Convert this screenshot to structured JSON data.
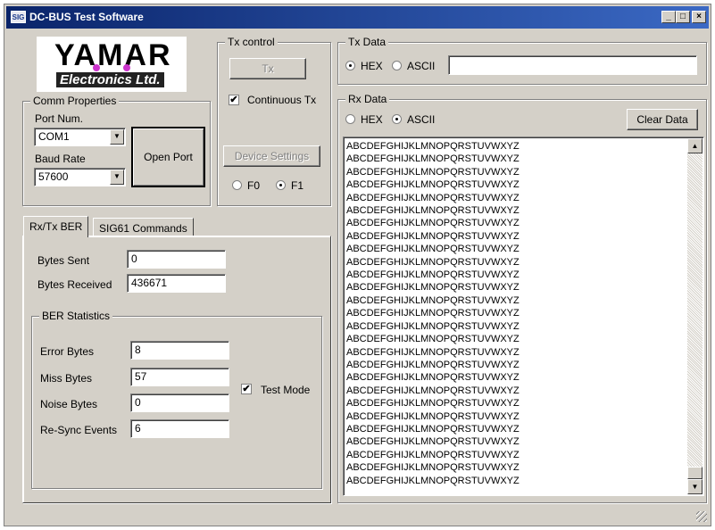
{
  "window": {
    "title": "DC-BUS Test Software",
    "icon_text": "SIG",
    "controls": {
      "minimize": "_",
      "maximize": "□",
      "close": "×"
    }
  },
  "logo": {
    "word1": "YAMAR",
    "word2": "Electronics Ltd."
  },
  "comm": {
    "group_label": "Comm Properties",
    "port_label": "Port Num.",
    "port_value": "COM1",
    "baud_label": "Baud Rate",
    "baud_value": "57600",
    "open_port_label": "Open Port"
  },
  "tx_control": {
    "group_label": "Tx control",
    "tx_button": "Tx",
    "continuous_label": "Continuous Tx",
    "continuous_checked": true,
    "device_settings_button": "Device Settings",
    "f0_label": "F0",
    "f1_label": "F1",
    "f1_selected": true
  },
  "tx_data": {
    "group_label": "Tx Data",
    "hex_label": "HEX",
    "ascii_label": "ASCII",
    "hex_selected": true,
    "input_value": ""
  },
  "rx_data": {
    "group_label": "Rx Data",
    "hex_label": "HEX",
    "ascii_label": "ASCII",
    "ascii_selected": true,
    "clear_button": "Clear Data",
    "lines": [
      "ABCDEFGHIJKLMNOPQRSTUVWXYZ",
      "ABCDEFGHIJKLMNOPQRSTUVWXYZ",
      "ABCDEFGHIJKLMNOPQRSTUVWXYZ",
      "ABCDEFGHIJKLMNOPQRSTUVWXYZ",
      "ABCDEFGHIJKLMNOPQRSTUVWXYZ",
      "ABCDEFGHIJKLMNOPQRSTUVWXYZ",
      "ABCDEFGHIJKLMNOPQRSTUVWXYZ",
      "ABCDEFGHIJKLMNOPQRSTUVWXYZ",
      "ABCDEFGHIJKLMNOPQRSTUVWXYZ",
      "ABCDEFGHIJKLMNOPQRSTUVWXYZ",
      "ABCDEFGHIJKLMNOPQRSTUVWXYZ",
      "ABCDEFGHIJKLMNOPQRSTUVWXYZ",
      "ABCDEFGHIJKLMNOPQRSTUVWXYZ",
      "ABCDEFGHIJKLMNOPQRSTUVWXYZ",
      "ABCDEFGHIJKLMNOPQRSTUVWXYZ",
      "ABCDEFGHIJKLMNOPQRSTUVWXYZ",
      "ABCDEFGHIJKLMNOPQRSTUVWXYZ",
      "ABCDEFGHIJKLMNOPQRSTUVWXYZ",
      "ABCDEFGHIJKLMNOPQRSTUVWXYZ",
      "ABCDEFGHIJKLMNOPQRSTUVWXYZ",
      "ABCDEFGHIJKLMNOPQRSTUVWXYZ",
      "ABCDEFGHIJKLMNOPQRSTUVWXYZ",
      "ABCDEFGHIJKLMNOPQRSTUVWXYZ",
      "ABCDEFGHIJKLMNOPQRSTUVWXYZ",
      "ABCDEFGHIJKLMNOPQRSTUVWXYZ",
      "ABCDEFGHIJKLMNOPQRSTUVWXYZ",
      "ABCDEFGHIJKLMNOPQRSTUVWXYZ"
    ]
  },
  "tabs": [
    {
      "label": "Rx/Tx BER",
      "active": true
    },
    {
      "label": "SIG61 Commands",
      "active": false
    }
  ],
  "ber": {
    "bytes_sent_label": "Bytes Sent",
    "bytes_sent_value": "0",
    "bytes_received_label": "Bytes Received",
    "bytes_received_value": "436671",
    "stats_group_label": "BER Statistics",
    "error_label": "Error Bytes",
    "error_value": "8",
    "miss_label": "Miss Bytes",
    "miss_value": "57",
    "noise_label": "Noise Bytes",
    "noise_value": "0",
    "resync_label": "Re-Sync Events",
    "resync_value": "6",
    "test_mode_label": "Test Mode",
    "test_mode_checked": true
  },
  "icons": {
    "dropdown_arrow": "▼",
    "scroll_up": "▲",
    "scroll_down": "▼",
    "checkmark": "✔"
  },
  "colors": {
    "titlebar_start": "#0a246a",
    "titlebar_end": "#3b69c4",
    "window_bg": "#d4d0c8",
    "logo_dot": "#cc33cc"
  }
}
